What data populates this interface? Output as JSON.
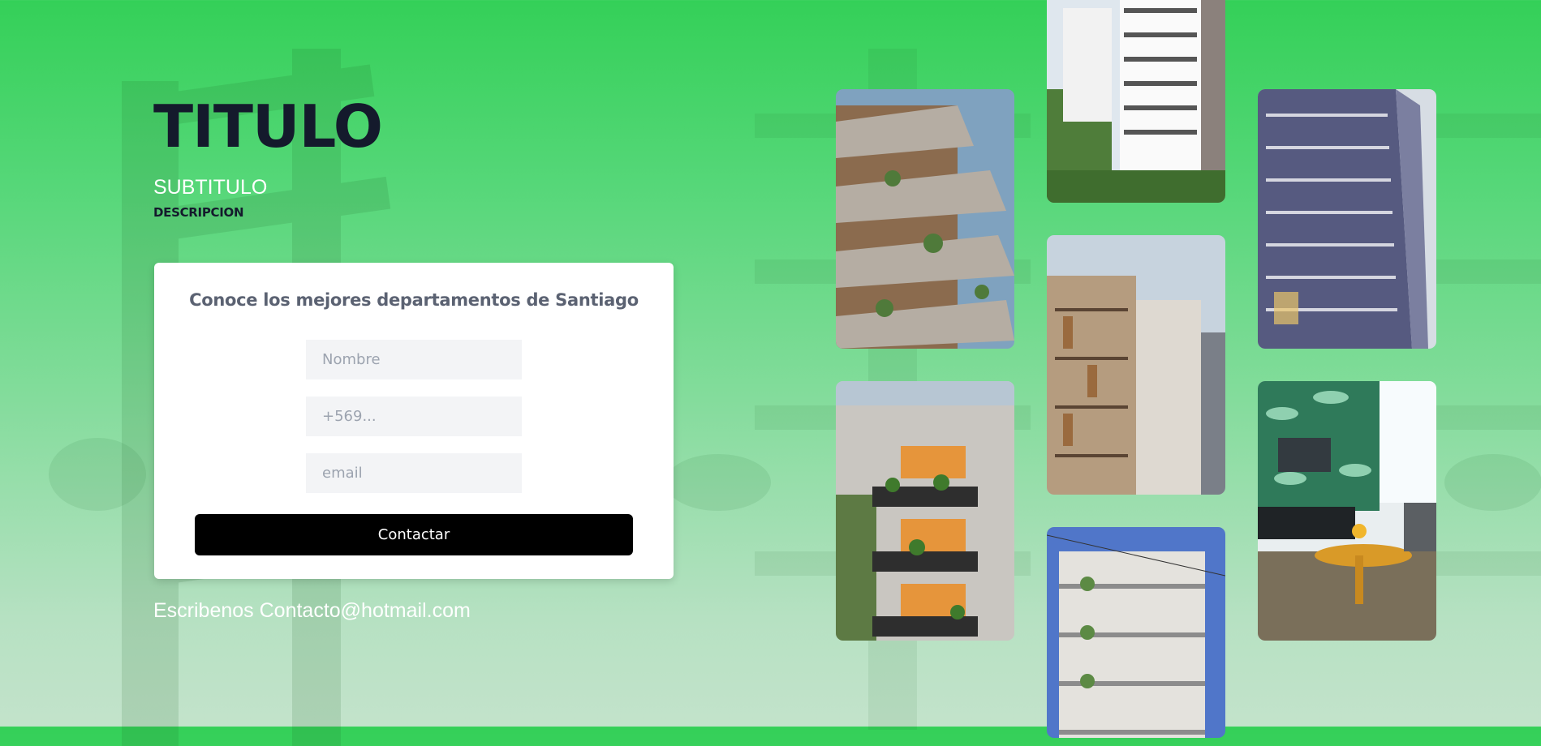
{
  "hero": {
    "title": "TITULO",
    "subtitle": "SUBTITULO",
    "description": "DESCRIPCION"
  },
  "form": {
    "heading": "Conoce los mejores departamentos de Santiago",
    "name_placeholder": "Nombre",
    "phone_placeholder": "+569...",
    "email_placeholder": "email",
    "submit_label": "Contactar"
  },
  "contact": {
    "text": "Escribenos Contacto@hotmail.com"
  },
  "gallery": {
    "photos": [
      {
        "subject": "building-cantilevered-balconies-photo"
      },
      {
        "subject": "building-planter-balconies-photo"
      },
      {
        "subject": "white-apartment-tower-photo"
      },
      {
        "subject": "wood-concrete-building-photo"
      },
      {
        "subject": "concrete-building-balconies-photo"
      },
      {
        "subject": "blue-apartment-tower-photo"
      },
      {
        "subject": "living-room-interior-photo"
      }
    ]
  },
  "colors": {
    "background_top": "#34d058",
    "background_bottom": "#c3e3cb",
    "title": "#141a2c",
    "card": "#ffffff",
    "heading": "#5b6272",
    "input_bg": "#f3f4f6",
    "button": "#000000"
  }
}
